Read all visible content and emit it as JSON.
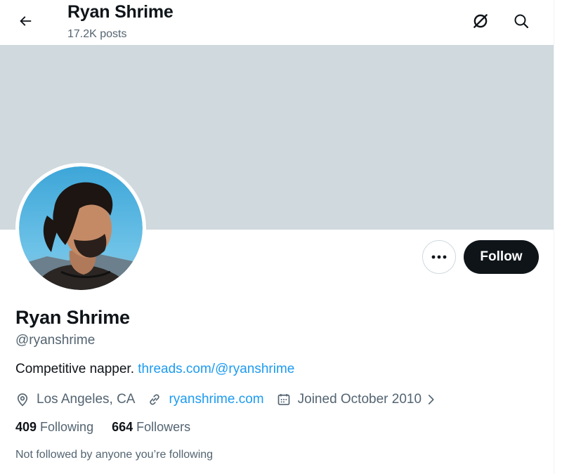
{
  "header": {
    "title": "Ryan Shrime",
    "posts_count": "17.2K posts"
  },
  "icons": {
    "back": "arrow-left-icon",
    "grok": "grok-icon",
    "search": "search-icon",
    "more": "more-dots-icon",
    "location": "location-pin-icon",
    "link": "link-icon",
    "calendar": "calendar-icon",
    "chevron": "chevron-right-icon"
  },
  "profile": {
    "display_name": "Ryan Shrime",
    "handle": "@ryanshrime",
    "bio_text": "Competitive napper. ",
    "bio_link": "threads.com/@ryanshrime",
    "location": "Los Angeles, CA",
    "website": "ryanshrime.com",
    "joined": "Joined October 2010",
    "following_count": "409",
    "following_label": "Following",
    "followers_count": "664",
    "followers_label": "Followers",
    "followed_by_note": "Not followed by anyone you’re following"
  },
  "actions": {
    "follow_label": "Follow"
  },
  "colors": {
    "banner": "#cfd9de",
    "link": "#1d9bf0",
    "follow_bg": "#0f1419",
    "secondary_text": "#536471"
  }
}
